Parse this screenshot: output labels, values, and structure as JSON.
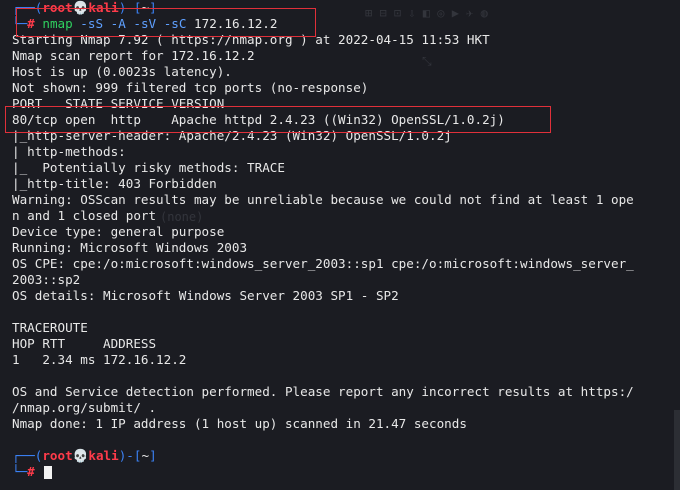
{
  "prompt1": {
    "user": "root",
    "skull": "💀",
    "host": "kali",
    "path": "~",
    "command_name": "nmap",
    "command_flags": "-sS -A -sV -sC",
    "command_target": "172.16.12.2"
  },
  "output_lines": [
    "Starting Nmap 7.92 ( https://nmap.org ) at 2022-04-15 11:53 HKT",
    "Nmap scan report for 172.16.12.2",
    "Host is up (0.0023s latency).",
    "Not shown: 999 filtered tcp ports (no-response)",
    "PORT   STATE SERVICE VERSION",
    "80/tcp open  http    Apache httpd 2.4.23 ((Win32) OpenSSL/1.0.2j)",
    "|_http-server-header: Apache/2.4.23 (Win32) OpenSSL/1.0.2j",
    "| http-methods:",
    "|_  Potentially risky methods: TRACE",
    "|_http-title: 403 Forbidden",
    "Warning: OSScan results may be unreliable because we could not find at least 1 ope",
    "n and 1 closed port",
    "Device type: general purpose",
    "Running: Microsoft Windows 2003",
    "OS CPE: cpe:/o:microsoft:windows_server_2003::sp1 cpe:/o:microsoft:windows_server_",
    "2003::sp2",
    "OS details: Microsoft Windows Server 2003 SP1 - SP2",
    "",
    "TRACEROUTE",
    "HOP RTT     ADDRESS",
    "1   2.34 ms 172.16.12.2",
    "",
    "OS and Service detection performed. Please report any incorrect results at https:/",
    "/nmap.org/submit/ .",
    "Nmap done: 1 IP address (1 host up) scanned in 21.47 seconds",
    ""
  ],
  "prompt2": {
    "user": "root",
    "skull": "💀",
    "host": "kali",
    "path": "~"
  },
  "colors": {
    "background": "#1b1c22",
    "prompt_frame": "#3b82f6",
    "user_host": "#ff3b4a",
    "command": "#2fd05f",
    "highlight_box": "#e0303a"
  }
}
